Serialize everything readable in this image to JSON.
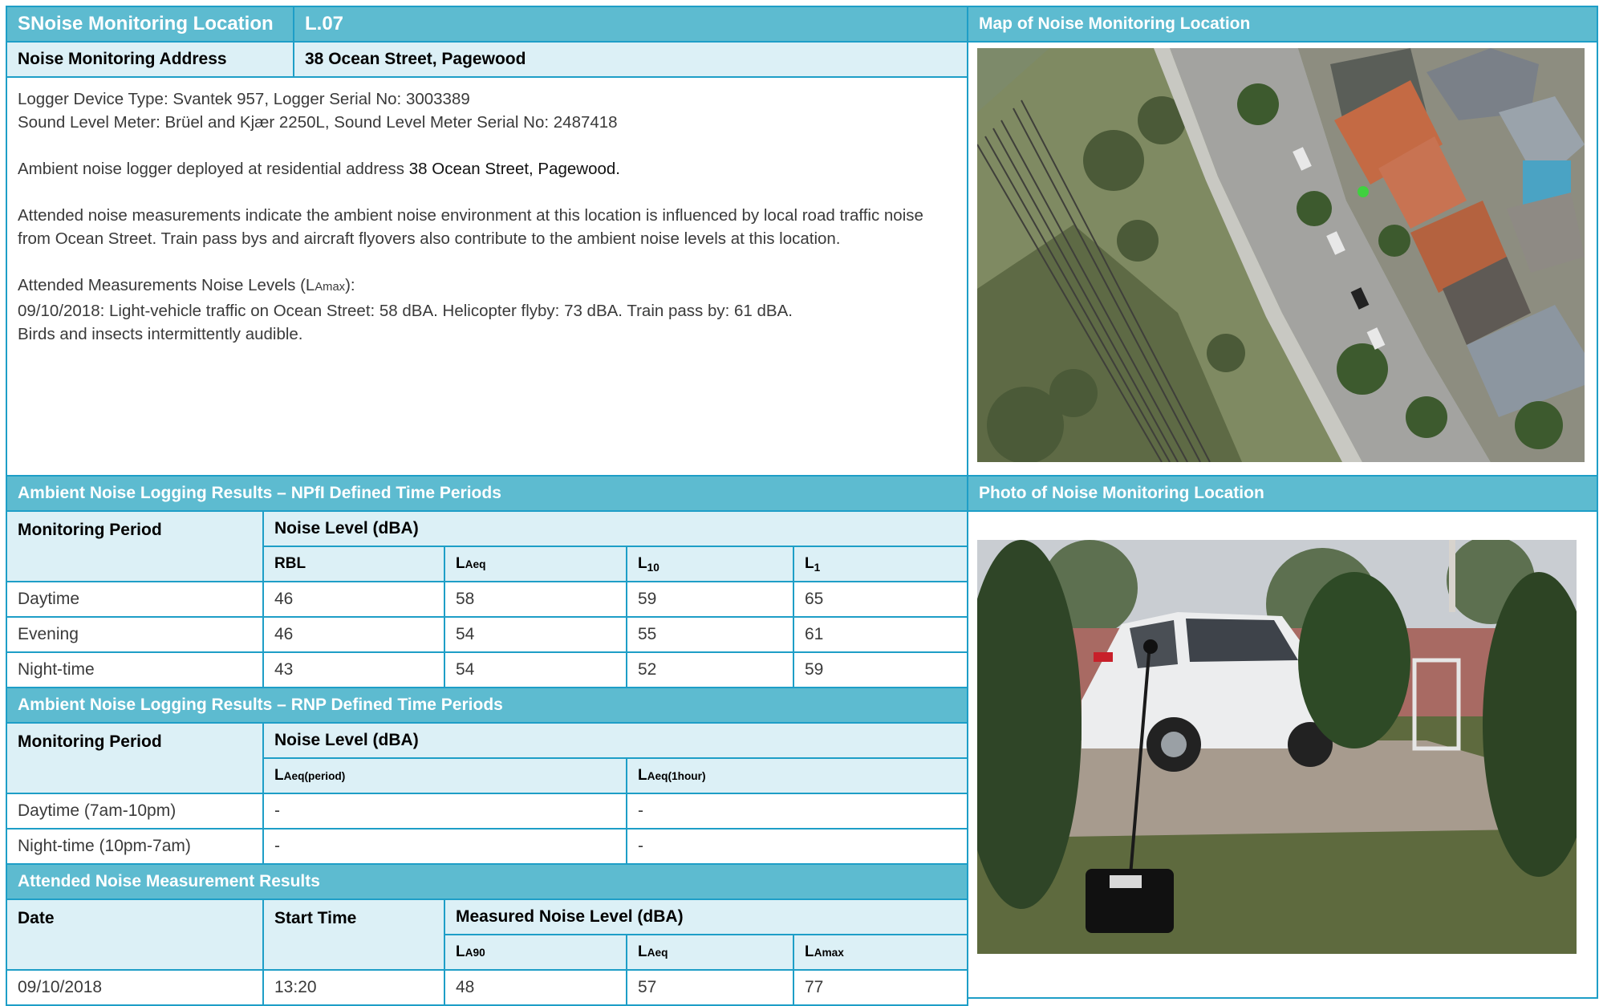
{
  "header": {
    "location_label": "SNoise Monitoring Location",
    "location_id": "L.07",
    "address_label": "Noise Monitoring Address",
    "address_value": "38 Ocean Street, Pagewood"
  },
  "description": {
    "logger_line": "Logger Device Type: Svantek 957, Logger Serial No: 3003389",
    "meter_line": "Sound Level Meter: Brüel and Kjær 2250L, Sound Level Meter Serial No: 2487418",
    "deploy_text": "Ambient noise logger deployed at residential address ",
    "deploy_address": "38 Ocean Street, Pagewood.",
    "influence_text": "Attended noise measurements indicate the ambient noise environment at this location is influenced by local road traffic noise from Ocean Street.  Train pass bys and aircraft flyovers also contribute to the ambient noise levels at this location.",
    "attended_heading_pre": "Attended Measurements Noise Levels (L",
    "attended_heading_sub": "Amax",
    "attended_heading_post": "):",
    "attended_line": "09/10/2018:  Light-vehicle traffic on Ocean Street: 58 dBA. Helicopter flyby: 73 dBA. Train pass by: 61 dBA.",
    "birds_line": "Birds and insects intermittently audible."
  },
  "map": {
    "title": "Map of Noise Monitoring Location",
    "marker_color": "#3fd13f"
  },
  "photo": {
    "title": "Photo of Noise Monitoring Location"
  },
  "npfi": {
    "title": "Ambient Noise Logging Results – NPfI Defined Time Periods",
    "period_header": "Monitoring Period",
    "level_header": "Noise Level (dBA)",
    "columns": [
      {
        "main": "RBL",
        "sub": ""
      },
      {
        "main": "L",
        "sub": "Aeq"
      },
      {
        "main": "L",
        "sub": "10"
      },
      {
        "main": "L",
        "sub": "1"
      }
    ],
    "rows": [
      {
        "period": "Daytime",
        "values": [
          "46",
          "58",
          "59",
          "65"
        ]
      },
      {
        "period": "Evening",
        "values": [
          "46",
          "54",
          "55",
          "61"
        ]
      },
      {
        "period": "Night-time",
        "values": [
          "43",
          "54",
          "52",
          "59"
        ]
      }
    ]
  },
  "rnp": {
    "title": "Ambient Noise Logging Results – RNP Defined Time Periods",
    "period_header": "Monitoring Period",
    "level_header": "Noise Level (dBA)",
    "columns": [
      {
        "main": "L",
        "sub": "Aeq(period)"
      },
      {
        "main": "L",
        "sub": "Aeq(1hour)"
      }
    ],
    "rows": [
      {
        "period": "Daytime (7am-10pm)",
        "values": [
          "-",
          "-"
        ]
      },
      {
        "period": "Night-time (10pm-7am)",
        "values": [
          "-",
          "-"
        ]
      }
    ]
  },
  "attended": {
    "title": "Attended Noise Measurement Results",
    "date_header": "Date",
    "start_header": "Start Time",
    "level_header": "Measured Noise Level (dBA)",
    "columns": [
      {
        "main": "L",
        "sub": "A90"
      },
      {
        "main": "L",
        "sub": "Aeq"
      },
      {
        "main": "L",
        "sub": "Amax"
      }
    ],
    "rows": [
      {
        "date": "09/10/2018",
        "start": "13:20",
        "values": [
          "48",
          "57",
          "77"
        ]
      }
    ]
  },
  "colors": {
    "header_bg": "#5dbbd0",
    "label_bg": "#dcf0f6",
    "border": "#1e9ec7"
  }
}
